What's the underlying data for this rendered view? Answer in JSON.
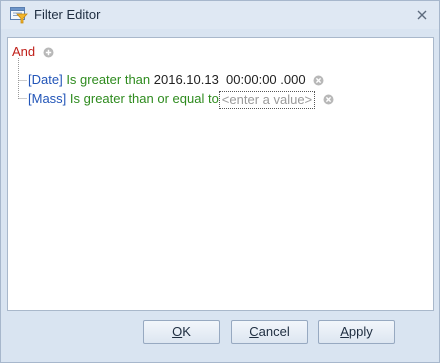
{
  "window": {
    "title": "Filter Editor"
  },
  "filter": {
    "group_operator": "And",
    "conditions": [
      {
        "field": "[Date]",
        "operator": "Is greater than",
        "value": "2016.10.13  00:00:00 .000"
      },
      {
        "field": "[Mass]",
        "operator": "Is greater than or equal to",
        "value_placeholder": "<enter a value>"
      }
    ]
  },
  "buttons": {
    "ok": {
      "hotkey": "O",
      "rest": "K"
    },
    "cancel": {
      "hotkey": "C",
      "rest": "ancel"
    },
    "apply": {
      "hotkey": "A",
      "rest": "pply"
    }
  },
  "colors": {
    "group_operator": "#c0201a",
    "field": "#2255b8",
    "operator": "#2e8b1e",
    "window_bg": "#d9e4f1"
  },
  "icons": {
    "title": "filter-editor-icon",
    "close": "close-icon",
    "add": "add-condition-icon",
    "remove": "remove-condition-icon"
  }
}
